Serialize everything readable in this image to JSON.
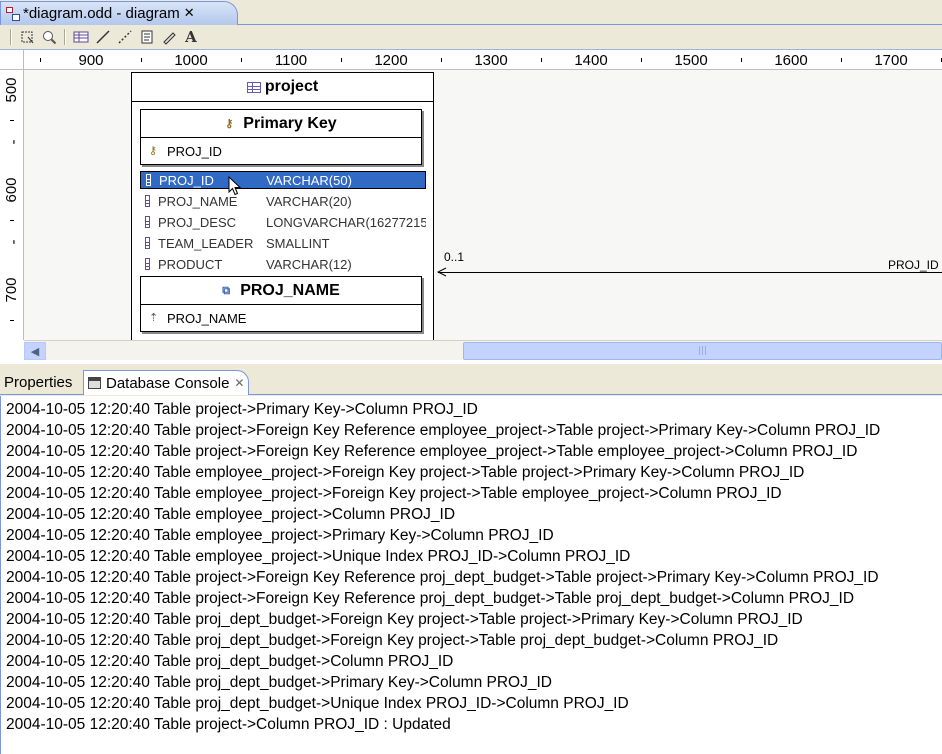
{
  "editor": {
    "tab_title": "*diagram.odd - diagram",
    "tab_close": "✕"
  },
  "toolbar": {
    "buttons": [
      "select-icon",
      "zoom-icon",
      "table-icon",
      "line-icon",
      "dotted-line-icon",
      "note-icon",
      "pen-icon",
      "text-icon"
    ]
  },
  "rulers": {
    "horizontal": [
      "900",
      "1000",
      "1100",
      "1200",
      "1300",
      "1400",
      "1500",
      "1600",
      "1700"
    ],
    "vertical": [
      "500",
      "-",
      "600",
      "-",
      "700"
    ]
  },
  "table": {
    "name": "project",
    "primary_key": {
      "title": "Primary Key",
      "columns": [
        "PROJ_ID"
      ]
    },
    "columns": [
      {
        "name": "PROJ_ID",
        "type": "VARCHAR(50)",
        "selected": true
      },
      {
        "name": "PROJ_NAME",
        "type": "VARCHAR(20)",
        "selected": false
      },
      {
        "name": "PROJ_DESC",
        "type": "LONGVARCHAR(16277215",
        "selected": false
      },
      {
        "name": "TEAM_LEADER",
        "type": "SMALLINT",
        "selected": false
      },
      {
        "name": "PRODUCT",
        "type": "VARCHAR(12)",
        "selected": false
      }
    ],
    "index": {
      "title": "PROJ_NAME",
      "columns": [
        "PROJ_NAME"
      ]
    }
  },
  "connection": {
    "cardinality": "0..1",
    "label": "PROJ_ID"
  },
  "views": {
    "tabs": [
      {
        "label": "Properties",
        "active": false
      },
      {
        "label": "Database Console",
        "active": true
      }
    ],
    "close": "✕"
  },
  "console": {
    "lines": [
      "2004-10-05 12:20:40 Table project->Primary Key->Column PROJ_ID",
      "2004-10-05 12:20:40 Table project->Foreign Key Reference employee_project->Table project->Primary Key->Column PROJ_ID",
      "2004-10-05 12:20:40 Table project->Foreign Key Reference employee_project->Table employee_project->Column PROJ_ID",
      "2004-10-05 12:20:40 Table employee_project->Foreign Key project->Table project->Primary Key->Column PROJ_ID",
      "2004-10-05 12:20:40 Table employee_project->Foreign Key project->Table employee_project->Column PROJ_ID",
      "2004-10-05 12:20:40 Table employee_project->Column PROJ_ID",
      "2004-10-05 12:20:40 Table employee_project->Primary Key->Column PROJ_ID",
      "2004-10-05 12:20:40 Table employee_project->Unique Index PROJ_ID->Column PROJ_ID",
      "2004-10-05 12:20:40 Table project->Foreign Key Reference proj_dept_budget->Table project->Primary Key->Column PROJ_ID",
      "2004-10-05 12:20:40 Table project->Foreign Key Reference proj_dept_budget->Table proj_dept_budget->Column PROJ_ID",
      "2004-10-05 12:20:40 Table proj_dept_budget->Foreign Key project->Table project->Primary Key->Column PROJ_ID",
      "2004-10-05 12:20:40 Table proj_dept_budget->Foreign Key project->Table proj_dept_budget->Column PROJ_ID",
      "2004-10-05 12:20:40 Table proj_dept_budget->Column PROJ_ID",
      "2004-10-05 12:20:40 Table proj_dept_budget->Primary Key->Column PROJ_ID",
      "2004-10-05 12:20:40 Table proj_dept_budget->Unique Index PROJ_ID->Column PROJ_ID",
      "2004-10-05 12:20:40 Table project->Column PROJ_ID : Updated"
    ]
  }
}
